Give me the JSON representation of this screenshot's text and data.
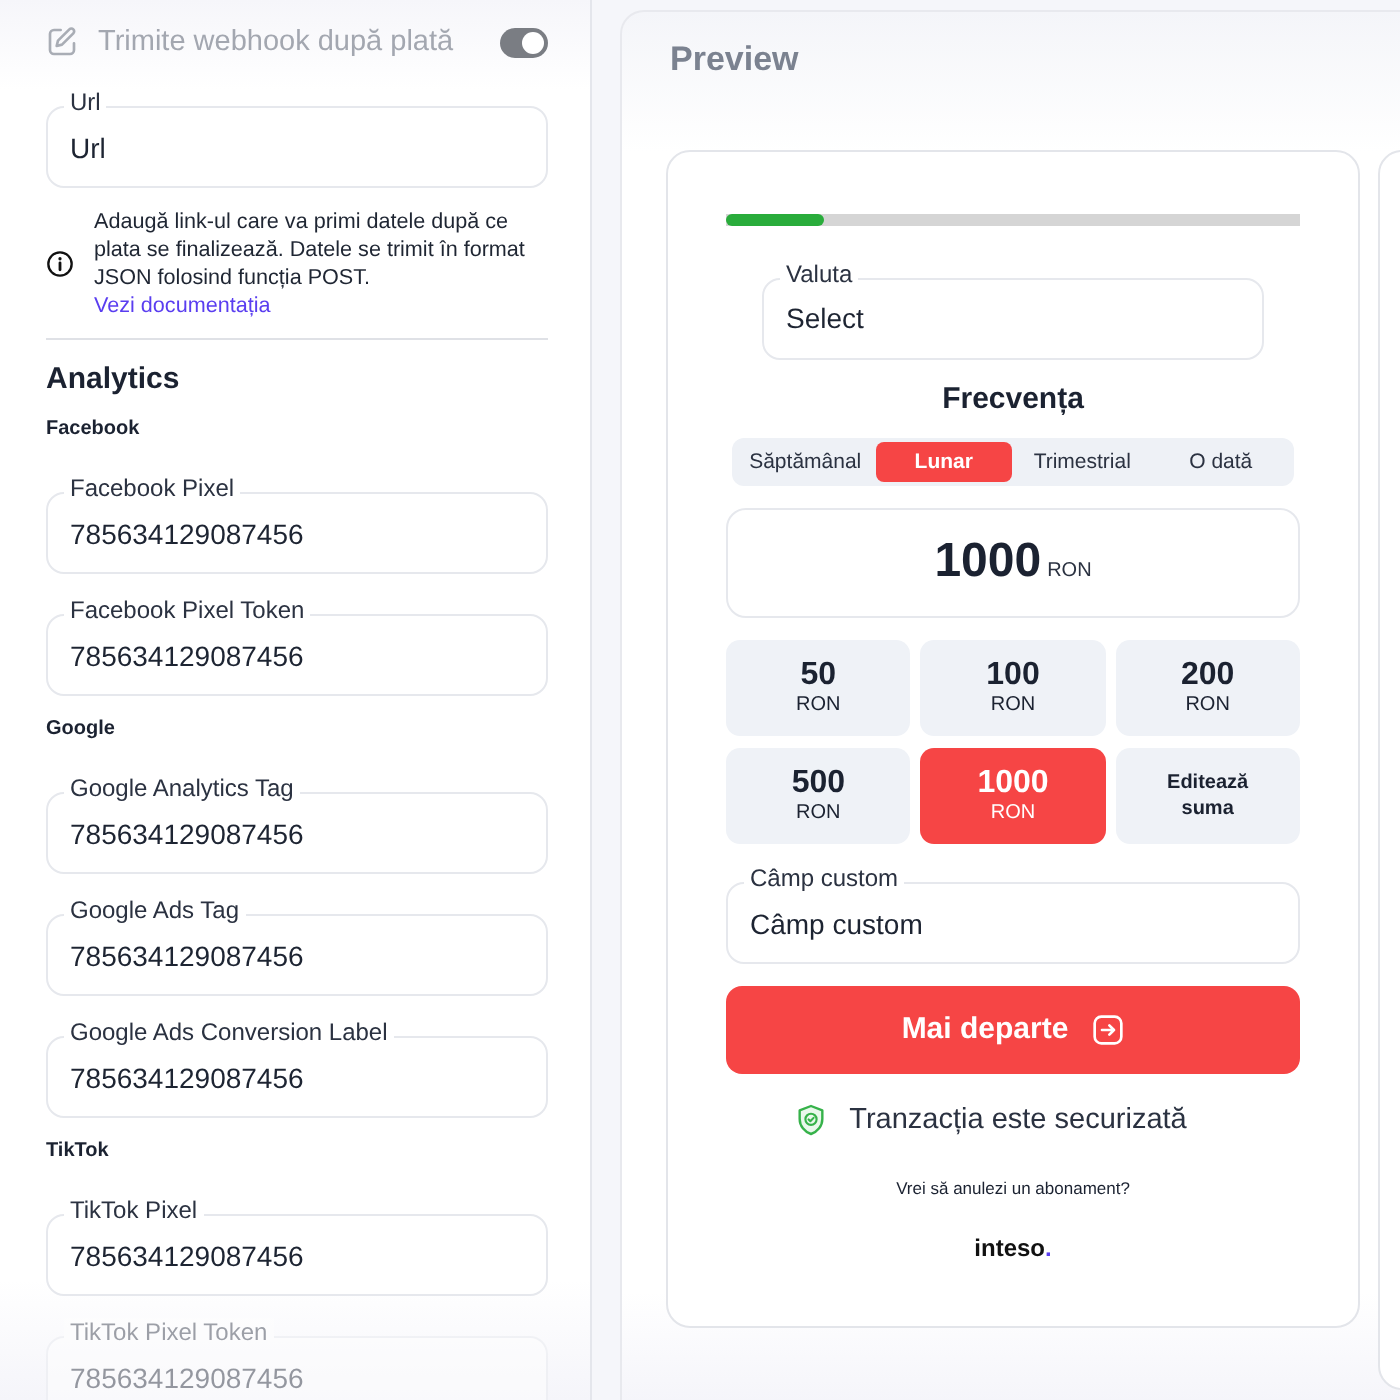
{
  "settings_panel": {
    "webhook": {
      "label": "Trimite webhook după plată",
      "on": true
    },
    "url_field": {
      "label": "Url",
      "value": "Url"
    },
    "info": {
      "text": "Adaugă link-ul care va primi datele după ce plata se finalizează. Datele se trimit în format JSON folosind funcția POST.",
      "link": "Vezi documentația"
    },
    "analytics": {
      "title": "Analytics",
      "groups": [
        {
          "title": "Facebook",
          "fields": [
            {
              "label": "Facebook Pixel",
              "value": "785634129087456"
            },
            {
              "label": "Facebook Pixel Token",
              "value": "785634129087456"
            }
          ]
        },
        {
          "title": "Google",
          "fields": [
            {
              "label": "Google Analytics Tag",
              "value": "785634129087456"
            },
            {
              "label": "Google Ads Tag",
              "value": "785634129087456"
            },
            {
              "label": "Google Ads Conversion Label",
              "value": "785634129087456"
            }
          ]
        },
        {
          "title": "TikTok",
          "fields": [
            {
              "label": "TikTok Pixel",
              "value": "785634129087456"
            },
            {
              "label": "TikTok Pixel Token",
              "value": "785634129087456"
            }
          ]
        }
      ]
    }
  },
  "preview": {
    "title": "Preview",
    "progress": {
      "level": 0.17
    },
    "currency_field": {
      "label": "Valuta",
      "value": "Select"
    },
    "frequency": {
      "title": "Frecvența",
      "options": [
        {
          "label": "Săptămânal",
          "selected": false
        },
        {
          "label": "Lunar",
          "selected": true
        },
        {
          "label": "Trimestrial",
          "selected": false
        },
        {
          "label": "O dată",
          "selected": false
        }
      ]
    },
    "amount_display": {
      "amount": "1000",
      "currency": "RON"
    },
    "amounts": [
      {
        "kind": "preset",
        "amount": "50",
        "currency": "RON",
        "selected": false
      },
      {
        "kind": "preset",
        "amount": "100",
        "currency": "RON",
        "selected": false
      },
      {
        "kind": "preset",
        "amount": "200",
        "currency": "RON",
        "selected": false
      },
      {
        "kind": "preset",
        "amount": "500",
        "currency": "RON",
        "selected": false
      },
      {
        "kind": "preset",
        "amount": "1000",
        "currency": "RON",
        "selected": true
      },
      {
        "kind": "edit",
        "label": "Editează suma",
        "selected": false
      }
    ],
    "custom_field": {
      "label": "Câmp custom",
      "value": "Câmp custom"
    },
    "submit_button": "Mai departe",
    "secure_note": "Tranzacția este securizată",
    "cancel_link": "Vrei să anulezi un abonament?",
    "brand": "inteso."
  }
}
